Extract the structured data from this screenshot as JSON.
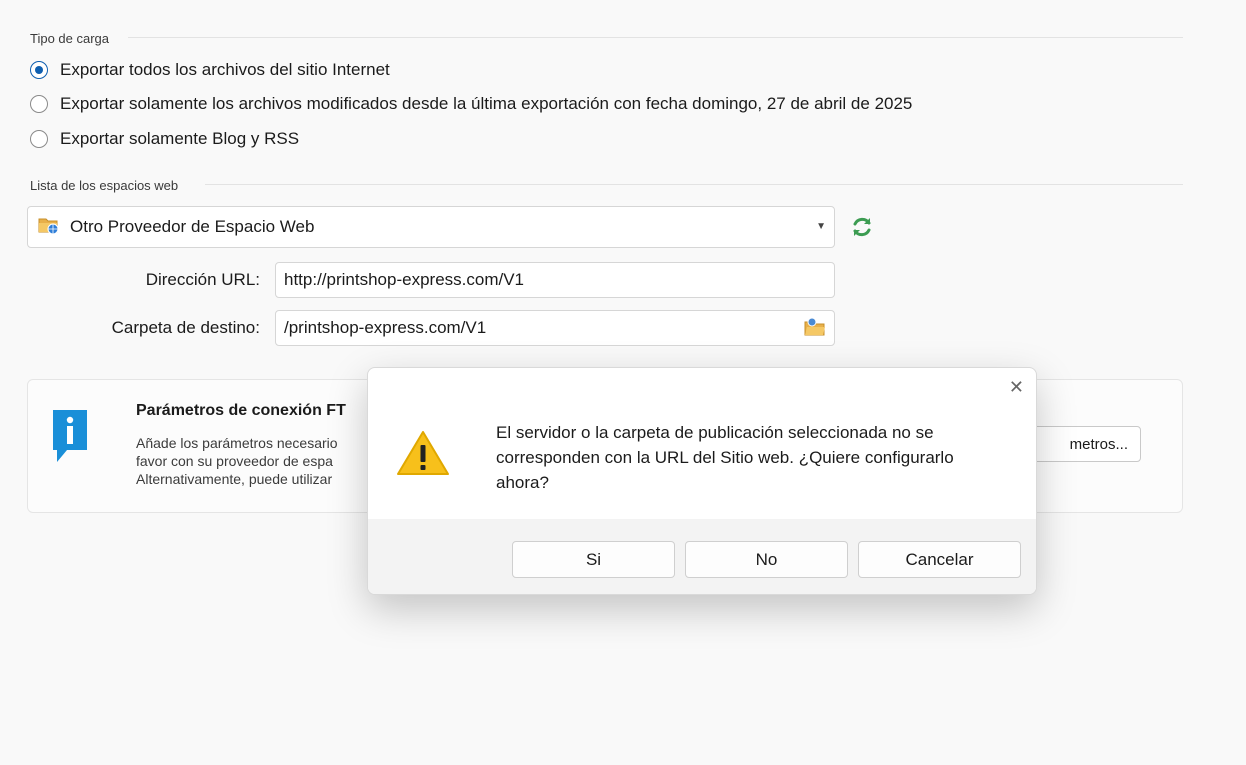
{
  "upload_type": {
    "heading": "Tipo de carga",
    "options": [
      {
        "label": "Exportar todos los archivos del sitio Internet",
        "selected": true
      },
      {
        "label": "Exportar solamente los archivos modificados desde la última exportación con fecha domingo, 27 de abril de 2025",
        "selected": false
      },
      {
        "label": "Exportar solamente Blog y RSS",
        "selected": false
      }
    ]
  },
  "webspaces": {
    "heading": "Lista de los espacios web",
    "selected": "Otro Proveedor de Espacio Web",
    "icon": "folder-globe-icon",
    "refresh_icon": "refresh-icon"
  },
  "form": {
    "url_label": "Dirección URL:",
    "url_value": "http://printshop-express.com/V1",
    "dest_label": "Carpeta de destino:",
    "dest_value": "/printshop-express.com/V1"
  },
  "info_panel": {
    "title": "Parámetros de conexión FT",
    "lines": [
      "Añade los parámetros necesario",
      "favor con su proveedor de espa",
      "Alternativamente, puede utilizar"
    ],
    "button_label": "metros..."
  },
  "dialog": {
    "message": "El servidor o la carpeta de publicación seleccionada no se corresponden con la URL del Sitio web. ¿Quiere configurarlo ahora?",
    "buttons": {
      "yes": "Si",
      "no": "No",
      "cancel": "Cancelar"
    },
    "close": "✕"
  },
  "colors": {
    "accent": "#0f5fb0",
    "refresh": "#3c9c52",
    "warning": "#f7c01b",
    "info": "#1a8fd8"
  }
}
